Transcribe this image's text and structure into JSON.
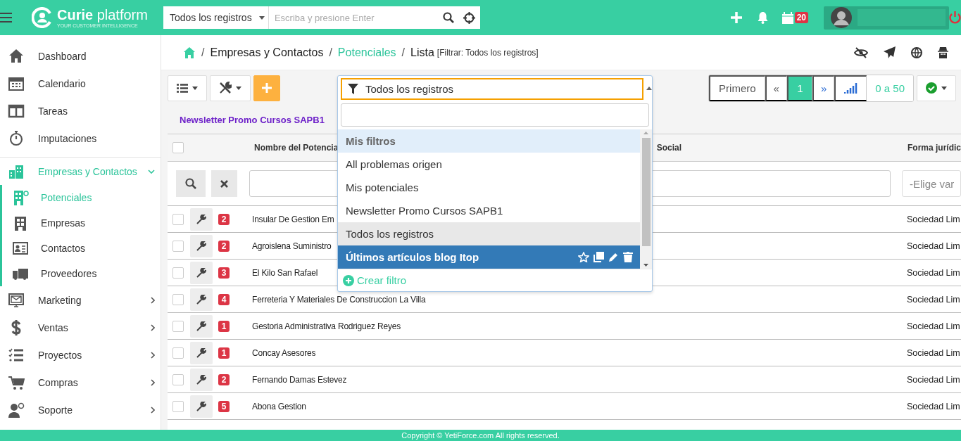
{
  "header": {
    "brand": "Curie",
    "brand_suffix": "platform",
    "tagline": "YOUR CUSTOMER INTELLIGENCE",
    "search": {
      "scope": "Todos los registros",
      "placeholder": "Escriba y presione Enter"
    },
    "calendar_badge": "20"
  },
  "sidebar": {
    "items": [
      {
        "label": "Dashboard",
        "selected": false
      },
      {
        "label": "Calendario",
        "selected": false
      },
      {
        "label": "Tareas",
        "selected": false
      },
      {
        "label": "Imputaciones",
        "selected": false
      },
      {
        "label": "Empresas y Contactos",
        "selected": true,
        "expanded": true,
        "children": [
          {
            "label": "Potenciales",
            "selected": true
          },
          {
            "label": "Empresas",
            "selected": false
          },
          {
            "label": "Contactos",
            "selected": false
          },
          {
            "label": "Proveedores",
            "selected": false
          }
        ]
      },
      {
        "label": "Marketing",
        "selected": false,
        "expanded": false
      },
      {
        "label": "Ventas",
        "selected": false,
        "expanded": false
      },
      {
        "label": "Proyectos",
        "selected": false,
        "expanded": false
      },
      {
        "label": "Compras",
        "selected": false,
        "expanded": false
      },
      {
        "label": "Soporte",
        "selected": false,
        "expanded": false
      }
    ]
  },
  "breadcrumb": {
    "items": [
      {
        "separator": "/",
        "label": "Empresas y Contactos",
        "highlighted": false
      },
      {
        "separator": "/",
        "label": "Potenciales",
        "highlighted": true
      },
      {
        "separator": "/",
        "label": "Lista",
        "highlighted": false
      }
    ],
    "filter_note": "[Filtrar: Todos los registros]"
  },
  "toolbar": {
    "filter": {
      "value": "Todos los registros",
      "open": true
    },
    "pagination": {
      "first": "Primero",
      "prev": "«",
      "pages": [
        {
          "label": "1",
          "selected": true
        }
      ],
      "next": "»",
      "range": "0 a 50"
    }
  },
  "tag_link": "Newsletter Promo Cursos SAPB1",
  "filter_dropdown": {
    "options": [
      {
        "label": "Mis filtros",
        "kind": "group",
        "selected": false,
        "highlighted": false
      },
      {
        "label": "All problemas origen",
        "kind": "option",
        "selected": false,
        "highlighted": false
      },
      {
        "label": "Mis potenciales",
        "kind": "option",
        "selected": false,
        "highlighted": false
      },
      {
        "label": "Newsletter Promo Cursos SAPB1",
        "kind": "option",
        "selected": false,
        "highlighted": false
      },
      {
        "label": "Todos los registros",
        "kind": "option",
        "selected": true,
        "highlighted": false
      },
      {
        "label": "Últimos artículos blog Itop",
        "kind": "option",
        "selected": false,
        "highlighted": true
      }
    ],
    "create_label": "Crear filtro"
  },
  "table": {
    "columns": [
      {
        "label": "Nombre del Potencia"
      },
      {
        "label": "Social"
      },
      {
        "label": "Forma jurídic"
      }
    ],
    "header_checked": false,
    "filter_select_placeholder": "-Elige var",
    "rows": [
      {
        "checked": false,
        "count": "2",
        "name": "Insular De Gestion Em",
        "forma": "Sociedad Lim"
      },
      {
        "checked": false,
        "count": "2",
        "name": "Agroislena Suministro",
        "forma": "Sociedad Lim"
      },
      {
        "checked": false,
        "count": "3",
        "name": "El Kilo San Rafael",
        "forma": "Sociedad Lim"
      },
      {
        "checked": false,
        "count": "4",
        "name": "Ferreteria Y Materiales De Construccion La Villa",
        "forma": "Sociedad Lim"
      },
      {
        "checked": false,
        "count": "1",
        "name": "Gestoria Administrativa Rodriguez Reyes",
        "forma": "Sociedad Lim"
      },
      {
        "checked": false,
        "count": "1",
        "name": "Concay Asesores",
        "forma": "Sociedad Lim"
      },
      {
        "checked": false,
        "count": "2",
        "name": "Fernando Damas Estevez",
        "forma": "Sociedad Lim"
      },
      {
        "checked": false,
        "count": "5",
        "name": "Abona Gestion",
        "forma": "Sociedad Lim"
      }
    ]
  },
  "footer": "Copyright © YetiForce.com All rights reserved."
}
